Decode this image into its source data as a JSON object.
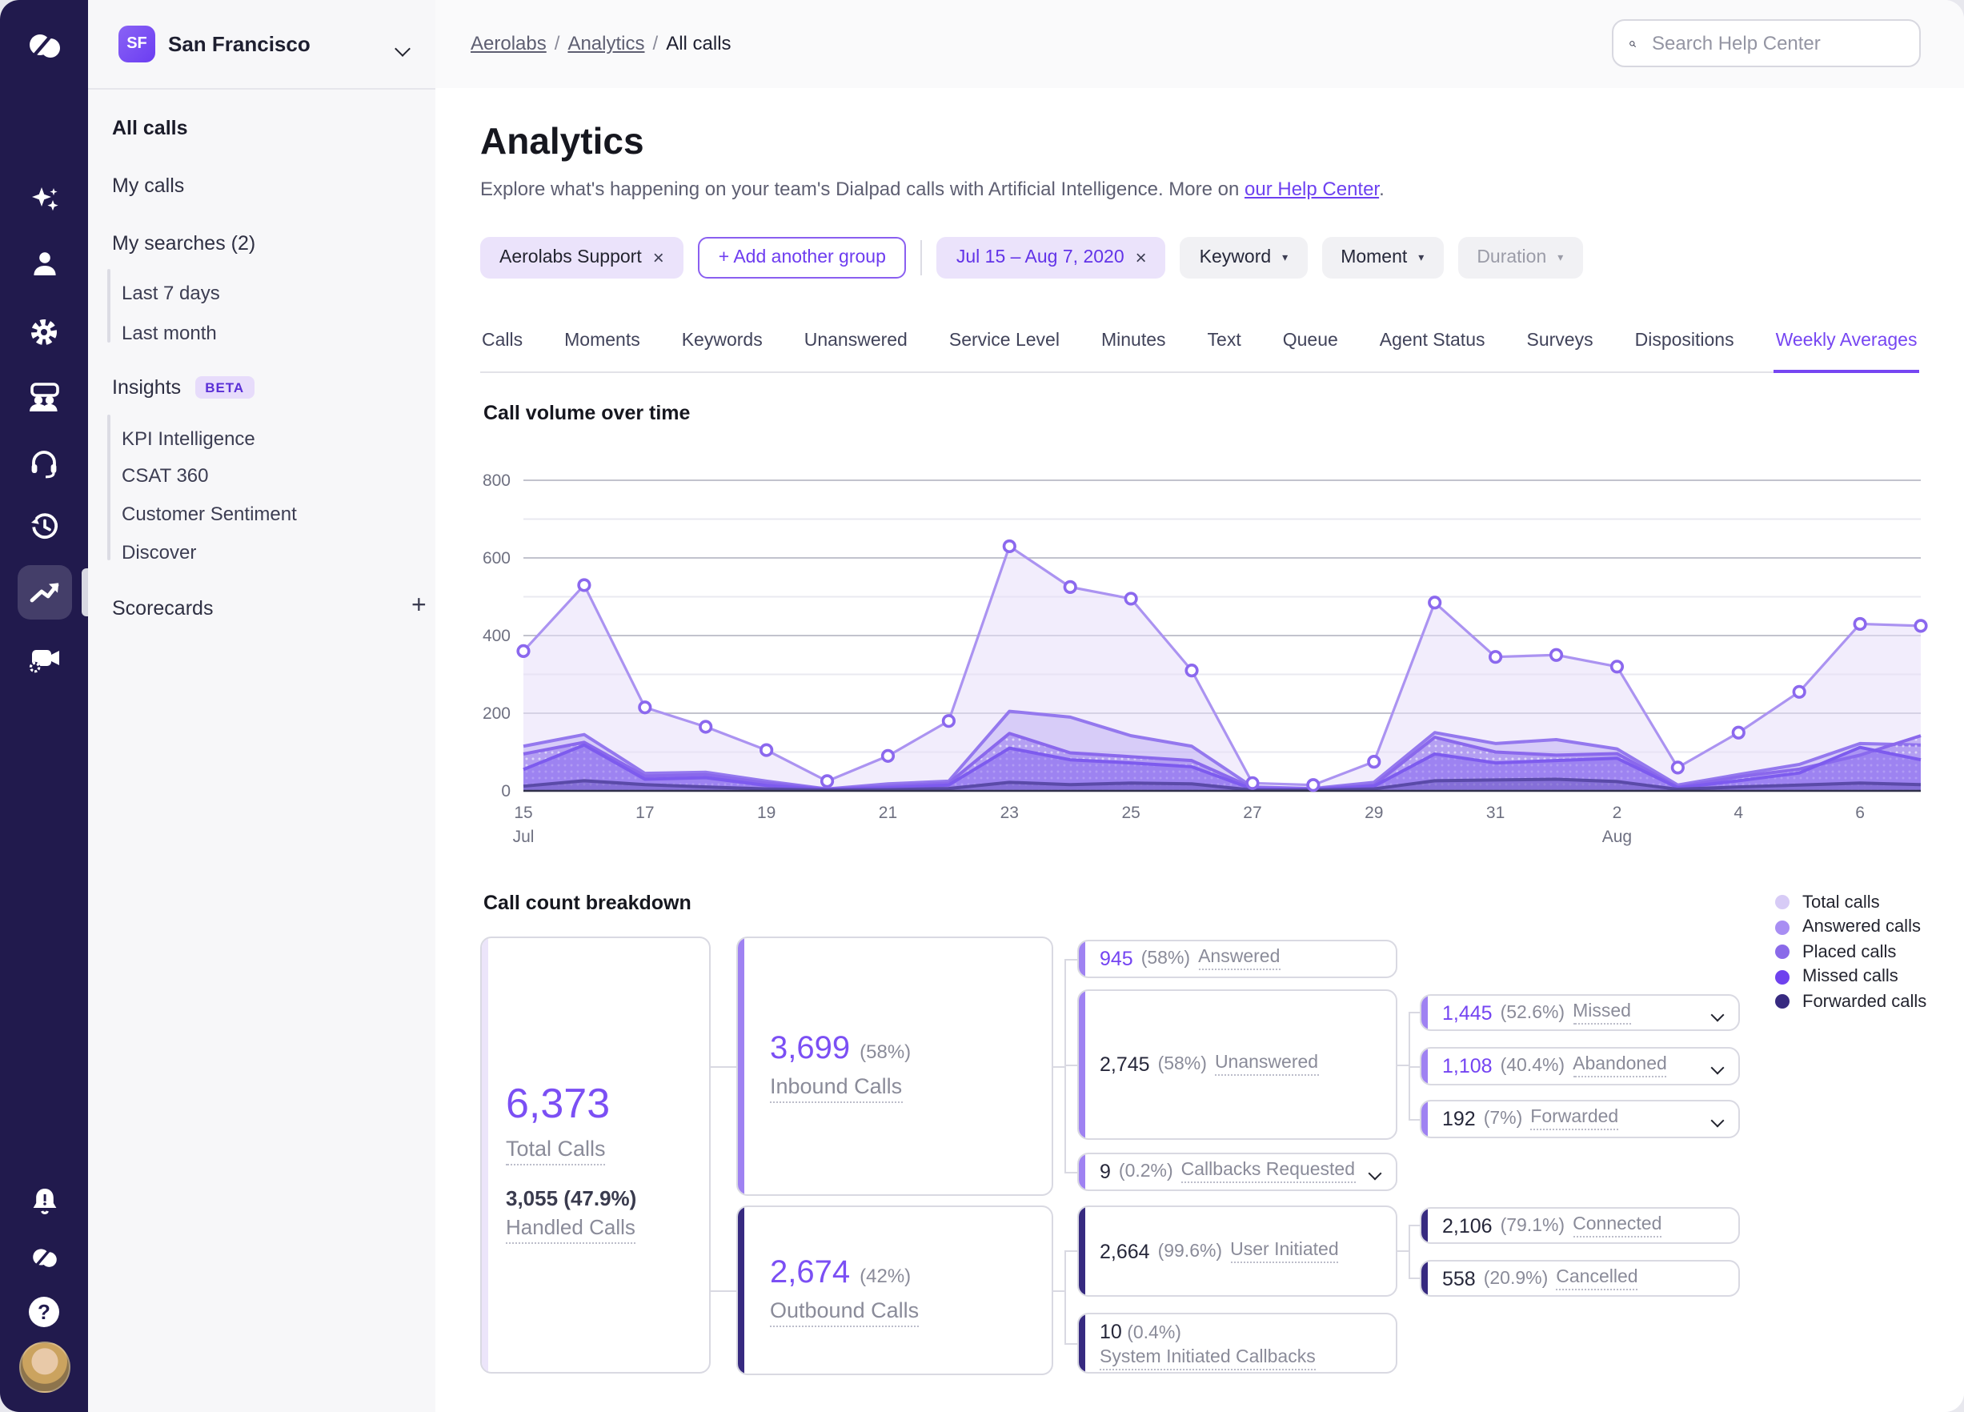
{
  "colors": {
    "accent": "#6b3df2",
    "rail_bg": "#211a4d",
    "purple_value": "#7444f2",
    "dark_accent": "#372a80",
    "light_accent": "#9f82f2",
    "total_accent": "#ece5fa"
  },
  "rail": {
    "icons": [
      "dialpad-logo",
      "ai-sparkles",
      "contacts",
      "settings",
      "coaching",
      "support-headset",
      "history",
      "analytics",
      "meetings"
    ],
    "bottom_icons": [
      "notifications-bell",
      "dialpad-mini",
      "help",
      "user-avatar"
    ],
    "active_icon": "analytics"
  },
  "org": {
    "badge": "SF",
    "name": "San Francisco"
  },
  "sidebar": {
    "items": [
      {
        "label": "All calls",
        "active": true
      },
      {
        "label": "My calls"
      },
      {
        "label": "My searches (2)"
      },
      {
        "label": "Last 7 days",
        "sub": true
      },
      {
        "label": "Last month",
        "sub": true
      },
      {
        "label": "Insights",
        "badge": "BETA"
      },
      {
        "label": "KPI Intelligence",
        "sub": true
      },
      {
        "label": "CSAT 360",
        "sub": true
      },
      {
        "label": "Customer Sentiment",
        "sub": true
      },
      {
        "label": "Discover",
        "sub": true
      },
      {
        "label": "Scorecards",
        "plus": "+"
      }
    ]
  },
  "topbar": {
    "breadcrumb": [
      "Aerolabs",
      "Analytics",
      "All calls"
    ],
    "search_placeholder": "Search Help Center"
  },
  "page": {
    "title": "Analytics",
    "description": "Explore what's happening on your team's Dialpad calls with Artificial Intelligence. More on ",
    "description_link": "our Help Center",
    "description_suffix": "."
  },
  "filters": [
    {
      "label": "Aerolabs Support",
      "close": true,
      "style": "lav"
    },
    {
      "label": "+ Add another group",
      "style": "outline"
    },
    {
      "divider": true
    },
    {
      "label": "Jul 15 – Aug 7, 2020",
      "close": true,
      "style": "lav-purple"
    },
    {
      "label": "Keyword",
      "caret": true,
      "style": "gray"
    },
    {
      "label": "Moment",
      "caret": true,
      "style": "gray"
    },
    {
      "label": "Duration",
      "caret": true,
      "style": "gray disabled"
    }
  ],
  "tabs": [
    "Calls",
    "Moments",
    "Keywords",
    "Unanswered",
    "Service Level",
    "Minutes",
    "Text",
    "Queue",
    "Agent Status",
    "Surveys",
    "Dispositions",
    "Weekly Averages"
  ],
  "active_tab": "Weekly Averages",
  "chart_data": {
    "type": "area",
    "title": "Call volume over time",
    "x": [
      "Jul 15",
      "Jul 16",
      "Jul 17",
      "Jul 18",
      "Jul 19",
      "Jul 20",
      "Jul 21",
      "Jul 22",
      "Jul 23",
      "Jul 24",
      "Jul 25",
      "Jul 26",
      "Jul 27",
      "Jul 28",
      "Jul 29",
      "Jul 30",
      "Jul 31",
      "Aug 1",
      "Aug 2",
      "Aug 3",
      "Aug 4",
      "Aug 5",
      "Aug 6",
      "Aug 7"
    ],
    "tick_labels": [
      {
        "index": 0,
        "label": "15"
      },
      {
        "index": 2,
        "label": "17"
      },
      {
        "index": 4,
        "label": "19"
      },
      {
        "index": 6,
        "label": "21"
      },
      {
        "index": 8,
        "label": "23"
      },
      {
        "index": 10,
        "label": "25"
      },
      {
        "index": 12,
        "label": "27"
      },
      {
        "index": 14,
        "label": "29"
      },
      {
        "index": 16,
        "label": "31"
      },
      {
        "index": 18,
        "label": "2"
      },
      {
        "index": 20,
        "label": "4"
      },
      {
        "index": 22,
        "label": "6"
      }
    ],
    "month_labels": [
      {
        "index": 0,
        "label": "Jul"
      },
      {
        "index": 18,
        "label": "Aug"
      }
    ],
    "ylim": [
      0,
      800
    ],
    "yticks": [
      0,
      200,
      400,
      600,
      800
    ],
    "grid": true,
    "legend_position": "right-of-breakdown",
    "series": [
      {
        "name": "Total calls",
        "stroke": "#ab93f1",
        "fill": "rgba(231,223,249,0.55)",
        "markers": true,
        "values": [
          360,
          530,
          215,
          165,
          105,
          25,
          90,
          180,
          630,
          525,
          495,
          310,
          20,
          15,
          75,
          485,
          345,
          350,
          320,
          60,
          150,
          255,
          430,
          425
        ]
      },
      {
        "name": "Answered calls",
        "stroke": "#9478ee",
        "fill": "rgba(148,120,238,0.28)",
        "markers": false,
        "values": [
          115,
          145,
          45,
          48,
          25,
          5,
          18,
          25,
          205,
          190,
          142,
          115,
          10,
          6,
          22,
          150,
          122,
          132,
          108,
          15,
          42,
          68,
          122,
          118
        ]
      },
      {
        "name": "Placed calls",
        "stroke": "#8a68ec",
        "fill": "rgba(138,104,236,0.45)",
        "markers": false,
        "pattern": true,
        "values": [
          95,
          125,
          38,
          42,
          20,
          4,
          12,
          20,
          148,
          98,
          88,
          78,
          8,
          5,
          15,
          138,
          100,
          92,
          96,
          10,
          36,
          56,
          92,
          142
        ]
      },
      {
        "name": "Missed calls",
        "stroke": "#7d5bee",
        "fill": "rgba(139,107,240,0.55)",
        "markers": false,
        "values": [
          55,
          118,
          30,
          34,
          14,
          3,
          8,
          15,
          110,
          80,
          72,
          62,
          5,
          3,
          12,
          95,
          72,
          78,
          84,
          8,
          26,
          46,
          112,
          80
        ]
      },
      {
        "name": "Forwarded calls",
        "stroke": "#5a4aa8",
        "fill": "rgba(90,74,168,0.35)",
        "markers": false,
        "values": [
          12,
          26,
          16,
          10,
          5,
          2,
          3,
          6,
          22,
          16,
          20,
          18,
          2,
          2,
          5,
          26,
          28,
          30,
          24,
          4,
          10,
          15,
          20,
          16
        ]
      }
    ]
  },
  "breakdown": {
    "title": "Call count breakdown",
    "legend": [
      {
        "label": "Total calls",
        "color": "#d7cbf6"
      },
      {
        "label": "Answered calls",
        "color": "#a88ef3"
      },
      {
        "label": "Placed calls",
        "color": "#8a6ae9"
      },
      {
        "label": "Missed calls",
        "color": "#6f42ee"
      },
      {
        "label": "Forwarded calls",
        "color": "#372a80"
      }
    ],
    "total": {
      "value": "6,373",
      "label": "Total Calls",
      "sub_value": "3,055 (47.9%)",
      "sub_label": "Handled Calls"
    },
    "inbound": {
      "value": "3,699",
      "pct": "(58%)",
      "label": "Inbound Calls"
    },
    "outbound": {
      "value": "2,674",
      "pct": "(42%)",
      "label": "Outbound Calls"
    },
    "nodes": [
      {
        "id": "answered",
        "value": "945",
        "pct": "(58%)",
        "label": "Answered",
        "highlight": true,
        "accent": "light"
      },
      {
        "id": "unanswered",
        "value": "2,745",
        "pct": "(58%)",
        "label": "Unanswered",
        "accent": "light"
      },
      {
        "id": "callbacks",
        "value": "9",
        "pct": "(0.2%)",
        "label": "Callbacks Requested",
        "chevron": true,
        "accent": "light"
      },
      {
        "id": "missed",
        "value": "1,445",
        "pct": "(52.6%)",
        "label": "Missed",
        "highlight": true,
        "chevron": true,
        "accent": "light"
      },
      {
        "id": "abandoned",
        "value": "1,108",
        "pct": "(40.4%)",
        "label": "Abandoned",
        "highlight": true,
        "chevron": true,
        "accent": "light"
      },
      {
        "id": "forwarded",
        "value": "192",
        "pct": "(7%)",
        "label": "Forwarded",
        "chevron": true,
        "accent": "light"
      },
      {
        "id": "user-initiated",
        "value": "2,664",
        "pct": "(99.6%)",
        "label": "User Initiated",
        "accent": "dark"
      },
      {
        "id": "connected",
        "value": "2,106",
        "pct": "(79.1%)",
        "label": "Connected",
        "accent": "dark"
      },
      {
        "id": "cancelled",
        "value": "558",
        "pct": "(20.9%)",
        "label": "Cancelled",
        "accent": "dark"
      },
      {
        "id": "system-callbacks",
        "value": "10",
        "pct": "(0.4%)",
        "label": "System Initiated Callbacks",
        "accent": "dark",
        "twoline": true
      }
    ]
  }
}
